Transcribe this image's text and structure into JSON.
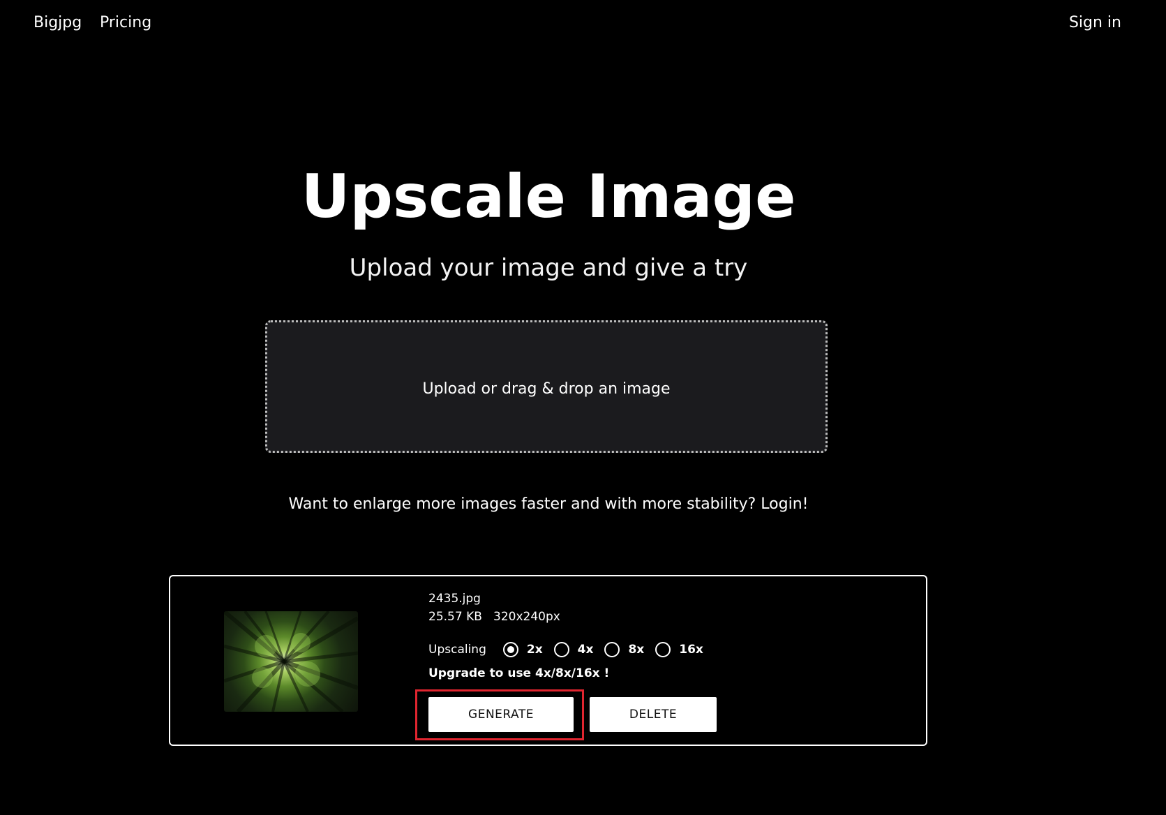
{
  "nav": {
    "brand": "Bigjpg",
    "pricing": "Pricing",
    "signin": "Sign in"
  },
  "hero": {
    "title": "Upscale Image",
    "subtitle": "Upload your image and give a try"
  },
  "dropzone": {
    "label": "Upload or drag & drop an image"
  },
  "promo": {
    "text": "Want to enlarge more images faster and with more stability? Login!"
  },
  "job": {
    "file_name": "2435.jpg",
    "file_size": "25.57 KB",
    "dimensions": "320x240px",
    "upscaling_label": "Upscaling",
    "options": [
      {
        "label": "2x",
        "checked": true
      },
      {
        "label": "4x",
        "checked": false
      },
      {
        "label": "8x",
        "checked": false
      },
      {
        "label": "16x",
        "checked": false
      }
    ],
    "upgrade_note": "Upgrade to use 4x/8x/16x !",
    "generate_label": "GENERATE",
    "delete_label": "DELETE"
  },
  "colors": {
    "background": "#000000",
    "dropzone_bg": "#1b1b1e",
    "highlight": "#e0252f",
    "button_bg": "#ffffff"
  }
}
